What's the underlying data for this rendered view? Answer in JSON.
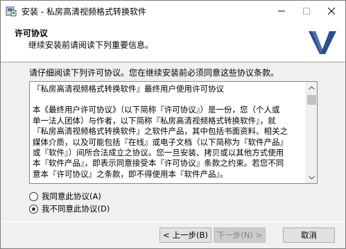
{
  "window": {
    "title": "安装 - 私房高清视频格式转换软件"
  },
  "header": {
    "title": "许可协议",
    "subtitle": "继续安装前请阅读下列重要信息。",
    "logo_icon": "v-logo-icon"
  },
  "main": {
    "instruction": "请仔细阅读下列许可协议。您在继续安装前必须同意这些协议条款。",
    "license_lines": [
      "『私房高清视频格式转换软件』最终用户使用许可协议",
      "",
      "本《最终用户许可协议》（以下简称『许可协议』）是一份，您（个人或",
      "单一法人团体）与作者，以下简称『私房高清视频格式转换软件』，就",
      "『私房高清视频格式转换软件』之软件产品，其中包括书面资料、相关之",
      "媒体介质，以及可能包括『在线』或电子文档（以下简称为『软件产品』",
      "或『软件』）间所合法成立之协议。您一旦安装、拷贝或以其他方式使用",
      "本『软件产品』，即表示同意接受本『许可协议』条款之约束。若您不同",
      "意本『许可协议』之条款，即不得使用本『软件产品』。"
    ],
    "radio_agree": "我同意此协议(A)",
    "radio_disagree": "我不同意此协议(D)",
    "selected": "disagree"
  },
  "footer": {
    "back_label": "< 上一步(B)",
    "next_label": "下一步(N) >",
    "cancel_label": "取消"
  },
  "colors": {
    "logo_blue": "#2b4f8c",
    "window_bg": "#f0f0f0"
  }
}
